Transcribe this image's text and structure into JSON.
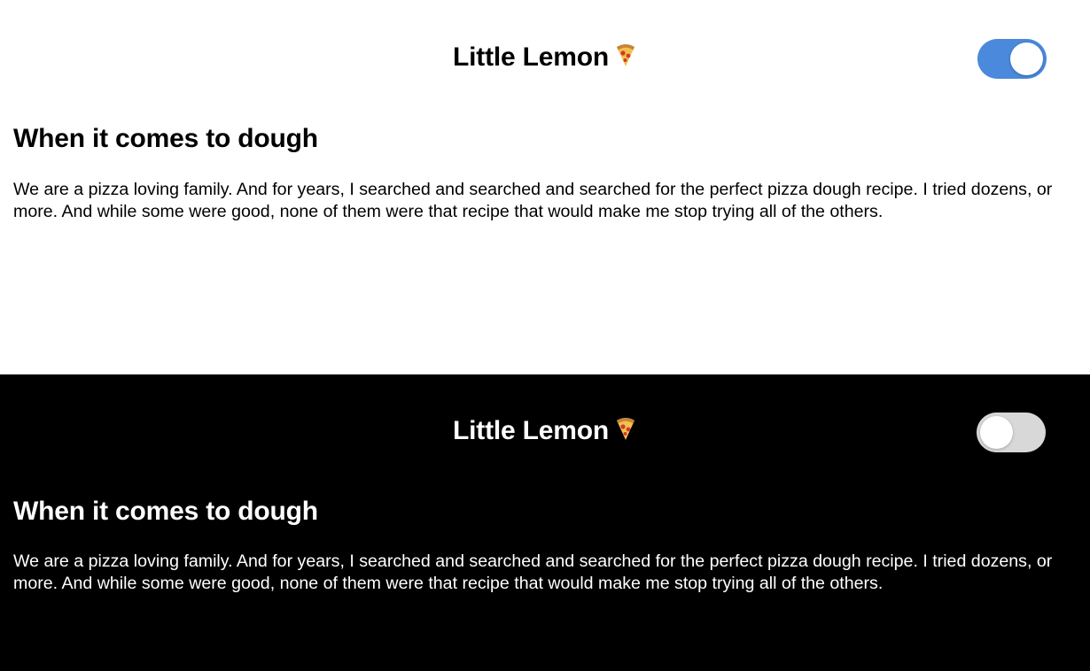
{
  "panels": [
    {
      "theme": "light",
      "background": "#ffffff",
      "header": {
        "title": "Little Lemon",
        "icon": "pizza-icon"
      },
      "toggle": {
        "checked": true,
        "track_color": "#4a89dc"
      },
      "section": {
        "heading": "When it comes to dough",
        "body": "We are a pizza loving family. And for years, I searched and searched and searched for the perfect pizza dough recipe. I tried dozens, or more. And while some were good, none of them were that recipe that would make me stop trying all of the others."
      }
    },
    {
      "theme": "dark",
      "background": "#000000",
      "header": {
        "title": "Little Lemon",
        "icon": "pizza-icon"
      },
      "toggle": {
        "checked": false,
        "track_color": "#d8d8d8"
      },
      "section": {
        "heading": "When it comes to dough",
        "body": "We are a pizza loving family. And for years, I searched and searched and searched for the perfect pizza dough recipe. I tried dozens, or more. And while some were good, none of them were that recipe that would make me stop trying all of the others."
      }
    }
  ]
}
